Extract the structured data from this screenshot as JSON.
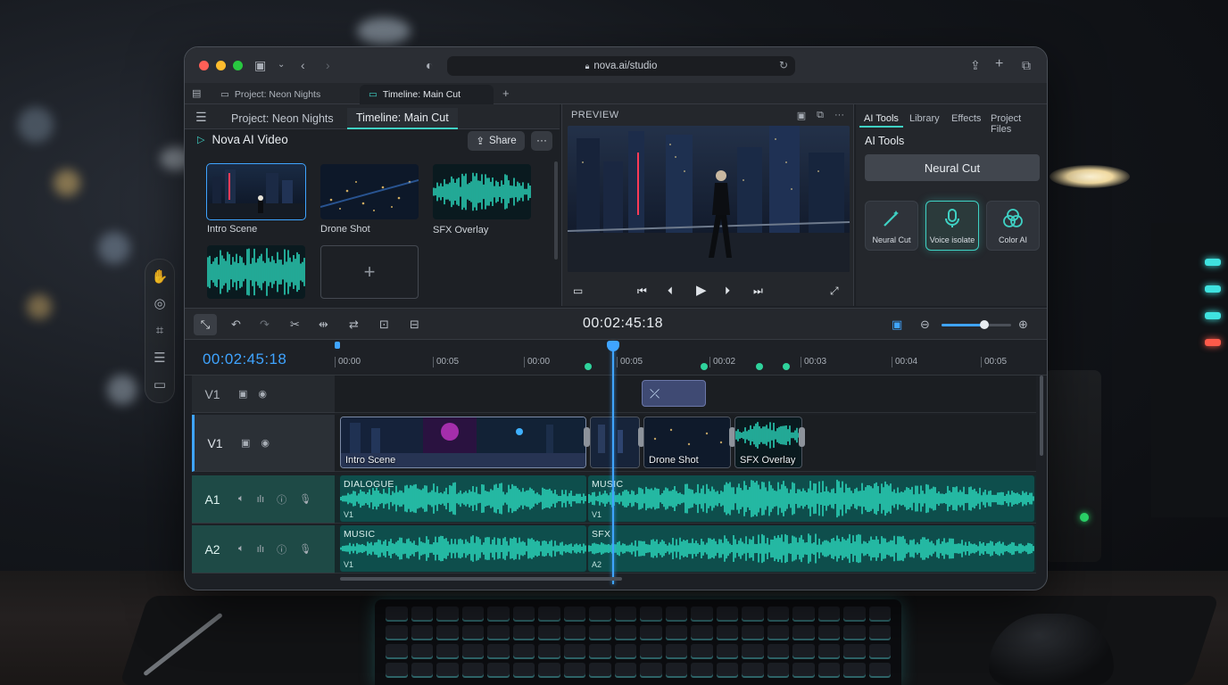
{
  "browser": {
    "url": "nova.ai/studio",
    "tabs": [
      {
        "label": "Project: Neon Nights"
      },
      {
        "label": "Timeline: Main Cut"
      }
    ],
    "new_tab_label": "+"
  },
  "left_panel": {
    "tabs": [
      {
        "label": "Project: Neon Nights"
      },
      {
        "label": "Timeline: Main Cut"
      }
    ],
    "app_title": "Nova AI Video",
    "share_label": "Share",
    "more_label": "···",
    "media": [
      {
        "label": "Intro Scene",
        "kind": "video-night-city",
        "selected": true
      },
      {
        "label": "Drone Shot",
        "kind": "video-aerial"
      },
      {
        "label": "SFX Overlay",
        "kind": "audio-wave"
      },
      {
        "label": "",
        "kind": "audio-wave"
      }
    ],
    "add_label": "+"
  },
  "preview": {
    "title": "PREVIEW",
    "icons": [
      "monitor-icon",
      "copy-icon",
      "more-icon"
    ],
    "transport": [
      "aspect-icon",
      "skip-start-icon",
      "step-back-icon",
      "play-icon",
      "step-forward-icon",
      "skip-end-icon",
      "fullscreen-icon"
    ]
  },
  "ai_panel": {
    "tabs": [
      {
        "label": "AI Tools",
        "active": true
      },
      {
        "label": "Library"
      },
      {
        "label": "Effects"
      },
      {
        "label": "Project Files"
      }
    ],
    "heading": "AI Tools",
    "primary_button": "Neural Cut",
    "tools": [
      {
        "label": "Neural Cut",
        "icon": "magic-wand-icon"
      },
      {
        "label": "Voice isolate",
        "icon": "microphone-icon",
        "active": true
      },
      {
        "label": "Color AI",
        "icon": "color-circles-icon"
      }
    ]
  },
  "timeline": {
    "current_time": "00:02:45:18",
    "ruler_timecode": "00:02:45:18",
    "ruler_ticks": [
      "00:00",
      "00:05",
      "00:00",
      "00:05",
      "00:02",
      "00:03",
      "00:04",
      "00:05"
    ],
    "zoom_level": 0.62,
    "tracks": [
      {
        "name": "V1",
        "type": "video"
      },
      {
        "name": "V1",
        "type": "video",
        "active": true
      },
      {
        "name": "A1",
        "type": "audio"
      },
      {
        "name": "A2",
        "type": "audio"
      }
    ],
    "video_clips": [
      {
        "label": "Intro Scene"
      },
      {
        "label": ""
      },
      {
        "label": "Drone Shot"
      },
      {
        "label": "SFX Overlay"
      }
    ],
    "audio_clips": {
      "a1": [
        {
          "label": "DIALOGUE",
          "sub": "V1"
        },
        {
          "label": "MUSIC",
          "sub": "V1"
        }
      ],
      "a2": [
        {
          "label": "MUSIC",
          "sub": "V1"
        },
        {
          "label": "SFX",
          "sub": "A2"
        }
      ]
    }
  },
  "colors": {
    "accent_teal": "#3fd1c4",
    "accent_blue": "#3fa4ff",
    "wave": "#2ee6c8"
  }
}
